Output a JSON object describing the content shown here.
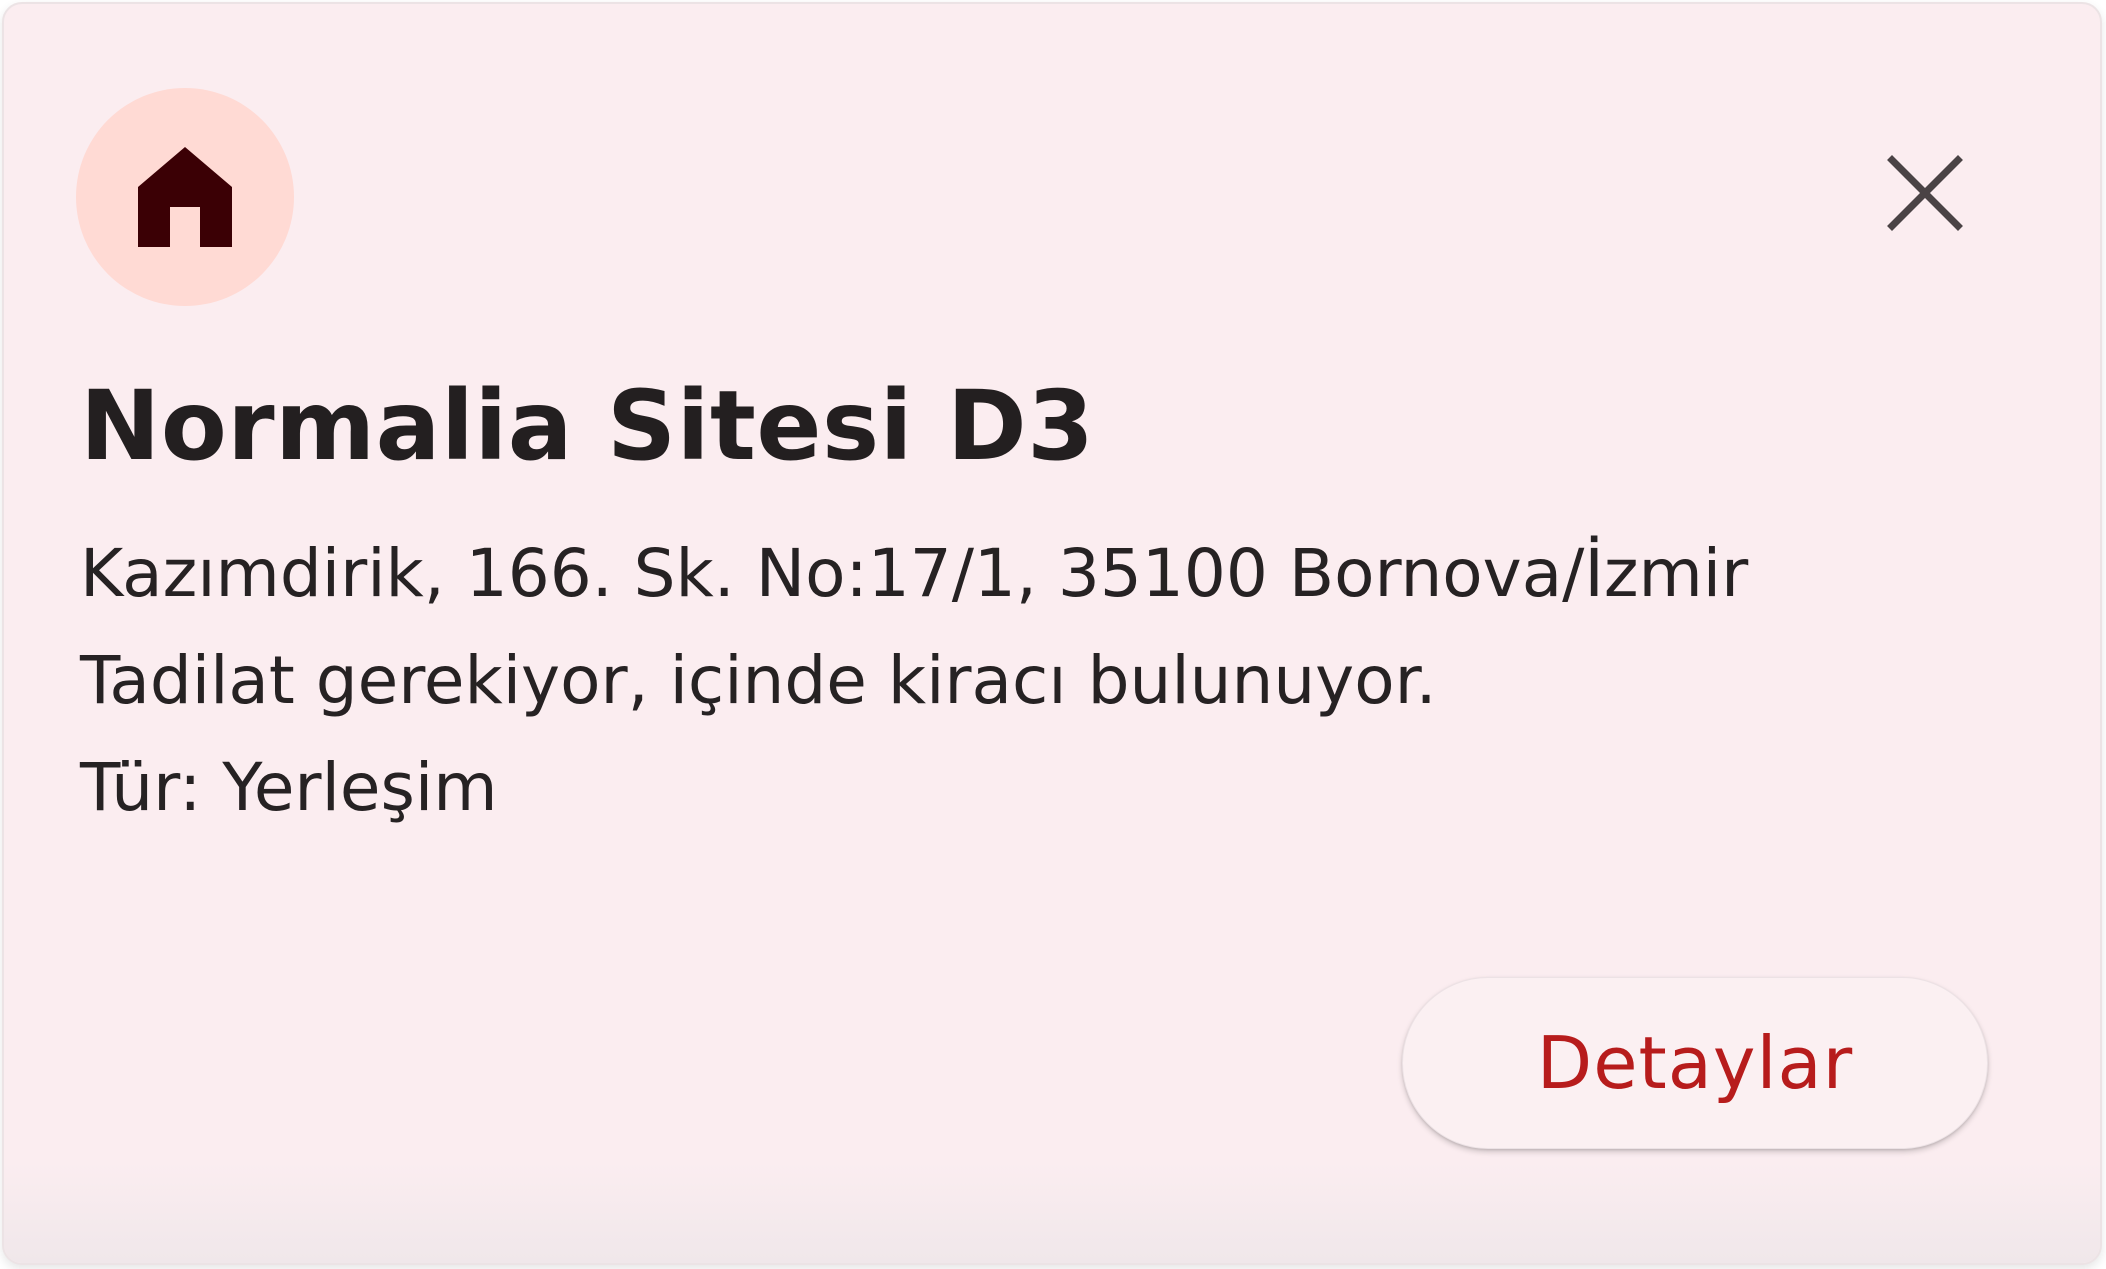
{
  "card": {
    "icon": "home-icon",
    "close_icon": "close-icon",
    "title": "Normalia Sitesi D3",
    "address": "Kazımdirik, 166. Sk. No:17/1, 35100 Bornova/İzmir",
    "note": "Tadilat gerekiyor, içinde kiracı bulunuyor.",
    "type": "Tür: Yerleşim",
    "details_button": "Detaylar"
  },
  "colors": {
    "card_background": "#fbedf0",
    "icon_circle": "#ffdad4",
    "icon": "#3b0005",
    "button_text": "#b71c1c"
  }
}
